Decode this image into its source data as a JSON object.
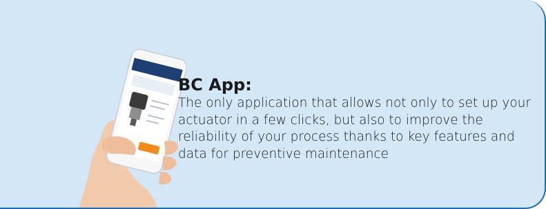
{
  "card": {
    "title": "BC App:",
    "description": "The only application that allows not only to set up your actuator in a few clicks, but also to improve the reliability of your process thanks to key features and data for preventive maintenance",
    "image_icon": "phone-in-hand-icon",
    "colors": {
      "background": "#d3e7f7",
      "border": "#1b6cb8",
      "app_header": "#1e3f73",
      "app_button": "#f08c1a"
    }
  }
}
